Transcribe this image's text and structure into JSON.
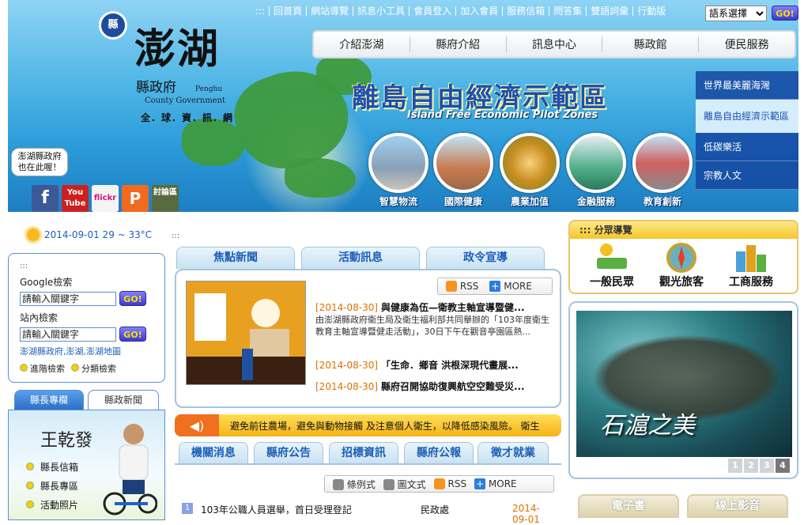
{
  "header": {
    "logo_text": "澎湖",
    "logo_sub": "縣政府",
    "logo_en1": "Penghu",
    "logo_en2": "County Government",
    "slogan": "全．球．資．訊．網",
    "top_links": [
      ":::",
      "回首頁",
      "網站導覽",
      "訊息小工具",
      "會員登入",
      "加入會員",
      "服務信箱",
      "問答集",
      "雙語詞彙",
      "行動版"
    ],
    "lang_select": "語系選擇",
    "go": "GO!",
    "main_nav": [
      "介紹澎湖",
      "縣府介紹",
      "訊息中心",
      "縣政館",
      "便民服務"
    ],
    "banner_title": "離島自由經濟示範區",
    "banner_sub": "Island Free Economic Pilot Zones",
    "bubble": "澎湖縣政府\n也在此喔！",
    "social": [
      "f",
      "You Tube",
      "flickr",
      "P",
      "討論區"
    ],
    "circles": [
      "智慧物流",
      "國際健康",
      "農業加值",
      "金融服務",
      "教育創新"
    ],
    "right_menu": [
      "世界最美麗海灣",
      "離島自由經濟示範區",
      "低碳樂活",
      "宗教人文"
    ]
  },
  "weather": {
    "text": "2014-09-01 29 ~ 33°C"
  },
  "dots": ":::",
  "search": {
    "dots": ":::",
    "google_label": "Google檢索",
    "google_value": "請輸入關鍵字",
    "site_label": "站內檢索",
    "site_value": "請輸入關鍵字",
    "go": "GO!",
    "links": "澎湖縣政府,澎湖,澎湖地圖",
    "adv1": "進階檢索",
    "adv2": "分類檢索"
  },
  "mayor": {
    "tab1": "縣長專欄",
    "tab2": "縣政新聞",
    "signature": "王乾發",
    "links": [
      "縣長信箱",
      "縣長專區",
      "活動照片"
    ]
  },
  "news": {
    "tabs": [
      "焦點新聞",
      "活動訊息",
      "政令宣導"
    ],
    "rss": "RSS",
    "more": "MORE",
    "items": [
      {
        "date": "[2014-08-30]",
        "title": "與健康為伍—衛教主軸宣導暨健...",
        "summary": "由澎湖縣政府衛生局及衛生福利部共同舉辦的「103年度衛生教育主軸宣導暨健走活動」，30日下午在觀音亭園區熱..."
      },
      {
        "date": "[2014-08-30]",
        "title": "「生命．鄉音 洪根深現代畫展...",
        "summary": ""
      },
      {
        "date": "[2014-08-30]",
        "title": "縣府召開協助復興航空空難受災...",
        "summary": ""
      }
    ]
  },
  "marquee": "避免前往農場，避免與動物接觸 及注意個人衛生，以降低感染風險。 衛生",
  "tabs2": {
    "tabs": [
      "機關消息",
      "縣府公告",
      "招標資訊",
      "縣府公報",
      "徵才就業"
    ],
    "list_style": "條例式",
    "grid_style": "圖文式",
    "rss": "RSS",
    "more": "MORE",
    "items": [
      {
        "num": "1",
        "title": "103年公職人員選舉，首日受理登記",
        "dept": "民政處",
        "date": "2014-09-01"
      }
    ]
  },
  "services": {
    "title": ":::  分眾導覽",
    "items": [
      "一般民眾",
      "觀光旅客",
      "工商服務"
    ]
  },
  "photo": {
    "caption": "石滬之美",
    "pages": [
      "1",
      "2",
      "3",
      "4"
    ],
    "active_page": "4"
  },
  "bottom_tabs": [
    "電子書",
    "線上影音"
  ]
}
